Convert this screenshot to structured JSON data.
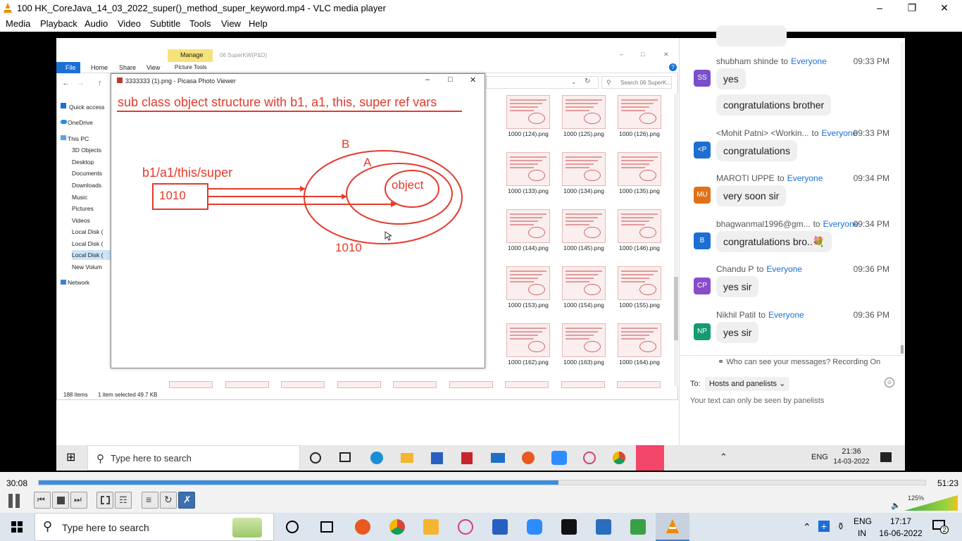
{
  "window": {
    "title": "100 HK_CoreJava_14_03_2022_super()_method_super_keyword.mp4 - VLC media player"
  },
  "menu": [
    "Media",
    "Playback",
    "Audio",
    "Video",
    "Subtitle",
    "Tools",
    "View",
    "Help"
  ],
  "explorer": {
    "manage_tab": "Manage",
    "folder_title": "06 SuperKW(P&D)",
    "ribbon": [
      "File",
      "Home",
      "Share",
      "View",
      "Picture Tools"
    ],
    "search_placeholder": "Search 06 SuperK...",
    "nav": [
      "Quick access",
      "OneDrive",
      "This PC",
      "3D Objects",
      "Desktop",
      "Documents",
      "Downloads",
      "Music",
      "Pictures",
      "Videos",
      "Local Disk (",
      "Local Disk (",
      "Local Disk (",
      "New Volum",
      "Network"
    ],
    "thumbnails": [
      [
        "1000 (124).png",
        "1000 (125).png",
        "1000 (126).png"
      ],
      [
        "1000 (133).png",
        "1000 (134).png",
        "1000 (135).png"
      ],
      [
        "1000 (144).png",
        "1000 (145).png",
        "1000 (146).png"
      ],
      [
        "1000 (153).png",
        "1000 (154).png",
        "1000 (155).png"
      ],
      [
        "1000 (162).png",
        "1000 (163).png",
        "1000 (164).png"
      ]
    ],
    "partial_col": [
      "ng",
      "ng",
      "ng",
      "ng",
      "ng"
    ],
    "status_items": "188 items",
    "status_selected": "1 item selected  49.7 KB"
  },
  "picasa": {
    "title": "3333333 (1).png - Picasa Photo Viewer",
    "heading": "sub class object structure with b1, a1, this, super ref vars",
    "ref_label": "b1/a1/this/super",
    "box_value": "1010",
    "label_b": "B",
    "label_a": "A",
    "label_object": "object",
    "address": "1010"
  },
  "chat": {
    "messages": [
      {
        "sender": "shubham shinde",
        "to": "to",
        "target": "Everyone",
        "time": "09:33 PM",
        "initials": "SS",
        "color": "#7b4fc9",
        "texts": [
          "yes",
          "congratulations brother"
        ]
      },
      {
        "sender": "<Mohit Patni> <Workin...",
        "to": "to",
        "target": "Everyone",
        "time": "09:33 PM",
        "initials": "<P",
        "color": "#1c6fd1",
        "texts": [
          "congratulations"
        ]
      },
      {
        "sender": "MAROTI UPPE",
        "to": "to",
        "target": "Everyone",
        "time": "09:34 PM",
        "initials": "MU",
        "color": "#e0701a",
        "texts": [
          "very soon sir"
        ]
      },
      {
        "sender": "bhagwanmal1996@gm...",
        "to": "to",
        "target": "Everyone",
        "time": "09:34 PM",
        "initials": "B",
        "color": "#1c6fd1",
        "texts": [
          "congratulations bro..💐"
        ]
      },
      {
        "sender": "Chandu P",
        "to": "to",
        "target": "Everyone",
        "time": "09:36 PM",
        "initials": "CP",
        "color": "#8a4cc9",
        "texts": [
          "yes sir"
        ]
      },
      {
        "sender": "Nikhil Patil",
        "to": "to",
        "target": "Everyone",
        "time": "09:36 PM",
        "initials": "NP",
        "color": "#159a73",
        "texts": [
          "yes sir"
        ]
      }
    ],
    "recording_note": "Who can see your messages? Recording On",
    "to_label": "To:",
    "recipient": "Hosts and panelists",
    "input_placeholder": "Your text can only be seen by panelists"
  },
  "inner_taskbar": {
    "search_placeholder": "Type here to search",
    "lang": "ENG",
    "time": "21:36",
    "date": "14-03-2022"
  },
  "player": {
    "elapsed": "30:08",
    "total": "51:23",
    "progress": 0.586,
    "volume": "125%"
  },
  "taskbar": {
    "search_placeholder": "Type here to search",
    "lang": "ENG",
    "region": "IN",
    "time": "17:17",
    "date": "16-06-2022",
    "notifications": "2"
  }
}
